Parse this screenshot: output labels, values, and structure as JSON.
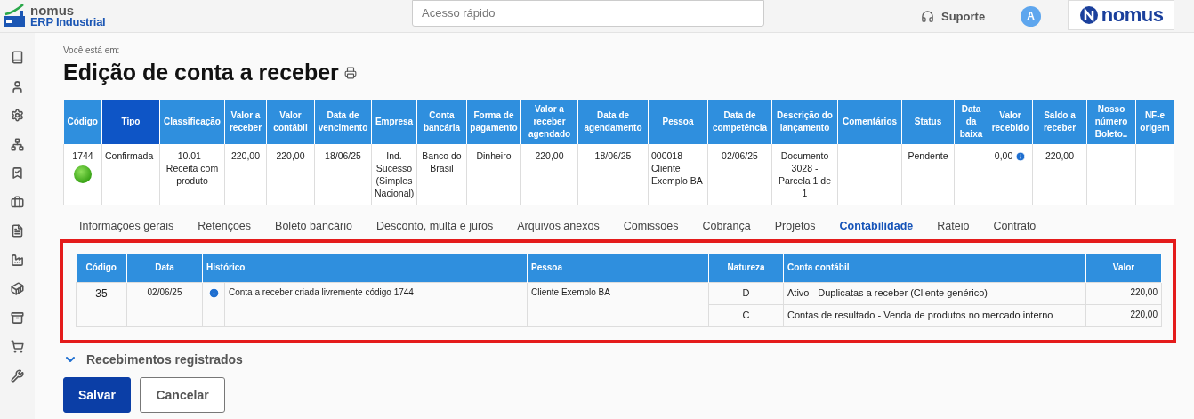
{
  "header": {
    "logo_top": "nomus",
    "logo_bottom": "ERP Industrial",
    "search": {
      "placeholder": "Acesso rápido"
    },
    "support": "Suporte",
    "avatar": "A",
    "brand": "nomus"
  },
  "breadcrumb": "Você está em:",
  "title": "Edição de conta a receber",
  "summary_table": {
    "columns": [
      {
        "label": "Código",
        "highlighted": false
      },
      {
        "label": "Tipo",
        "highlighted": true
      },
      {
        "label": "Classificação",
        "highlighted": false
      },
      {
        "label": "Valor a receber",
        "highlighted": false
      },
      {
        "label": "Valor contábil",
        "highlighted": false
      },
      {
        "label": "Data de vencimento",
        "highlighted": false
      },
      {
        "label": "Empresa",
        "highlighted": false
      },
      {
        "label": "Conta bancária",
        "highlighted": false
      },
      {
        "label": "Forma de pagamento",
        "highlighted": false
      },
      {
        "label": "Valor a receber agendado",
        "highlighted": false
      },
      {
        "label": "Data de agendamento",
        "highlighted": false
      },
      {
        "label": "Pessoa",
        "highlighted": false
      },
      {
        "label": "Data de competência",
        "highlighted": false
      },
      {
        "label": "Descrição do lançamento",
        "highlighted": false
      },
      {
        "label": "Comentários",
        "highlighted": false
      },
      {
        "label": "Status",
        "highlighted": false
      },
      {
        "label": "Data da baixa",
        "highlighted": false
      },
      {
        "label": "Valor recebido",
        "highlighted": false
      },
      {
        "label": "Saldo a receber",
        "highlighted": false
      },
      {
        "label": "Nosso número Boleto..",
        "highlighted": false
      },
      {
        "label": "NF-e origem",
        "highlighted": false
      }
    ],
    "row": [
      {
        "text": "1744",
        "kind": "status"
      },
      {
        "text": "Confirmada",
        "kind": "left"
      },
      {
        "text": "10.01 - Receita com produto",
        "kind": "center"
      },
      {
        "text": "220,00",
        "kind": "center"
      },
      {
        "text": "220,00",
        "kind": "center"
      },
      {
        "text": "18/06/25",
        "kind": "center"
      },
      {
        "text": "Ind. Sucesso (Simples Nacional)",
        "kind": "center"
      },
      {
        "text": "Banco do Brasil",
        "kind": "center"
      },
      {
        "text": "Dinheiro",
        "kind": "center"
      },
      {
        "text": "220,00",
        "kind": "center"
      },
      {
        "text": "18/06/25",
        "kind": "center"
      },
      {
        "text": "000018 - Cliente Exemplo BA",
        "kind": "left"
      },
      {
        "text": "02/06/25",
        "kind": "center"
      },
      {
        "text": "Documento 3028 - Parcela 1 de 1",
        "kind": "center"
      },
      {
        "text": "---",
        "kind": "center"
      },
      {
        "text": "Pendente",
        "kind": "center"
      },
      {
        "text": "---",
        "kind": "center"
      },
      {
        "text": "0,00",
        "kind": "info"
      },
      {
        "text": "220,00",
        "kind": "center"
      },
      {
        "kind": "center"
      },
      {
        "text": "---",
        "kind": "right"
      }
    ]
  },
  "tabs": [
    {
      "label": "Informações gerais",
      "selected": false
    },
    {
      "label": "Retenções",
      "selected": false
    },
    {
      "label": "Boleto bancário",
      "selected": false
    },
    {
      "label": "Desconto, multa e juros",
      "selected": false
    },
    {
      "label": "Arquivos anexos",
      "selected": false
    },
    {
      "label": "Comissões",
      "selected": false
    },
    {
      "label": "Cobrança",
      "selected": false
    },
    {
      "label": "Projetos",
      "selected": false
    },
    {
      "label": "Contabilidade",
      "selected": true
    },
    {
      "label": "Rateio",
      "selected": false
    },
    {
      "label": "Contrato",
      "selected": false
    }
  ],
  "accounting": {
    "highlighted": true,
    "columns": [
      "Código",
      "Data",
      "Histórico",
      "Pessoa",
      "Natureza",
      "Conta contábil",
      "Valor"
    ],
    "entries": [
      {
        "codigo": "35",
        "data": "02/06/25",
        "historico": "Conta a receber criada livremente código 1744",
        "pessoa": "Cliente Exemplo BA",
        "lines": [
          {
            "natureza": "D",
            "conta": "Ativo - Duplicatas a receber (Cliente genérico)",
            "valor": "220,00"
          },
          {
            "natureza": "C",
            "conta": "Contas de resultado - Venda de produtos no mercado interno",
            "valor": "220,00"
          }
        ]
      }
    ]
  },
  "receipts": {
    "label": "Recebimentos registrados"
  },
  "buttons": [
    {
      "label": "Salvar",
      "kind": "primary"
    },
    {
      "label": "Cancelar",
      "kind": "secondary"
    }
  ]
}
